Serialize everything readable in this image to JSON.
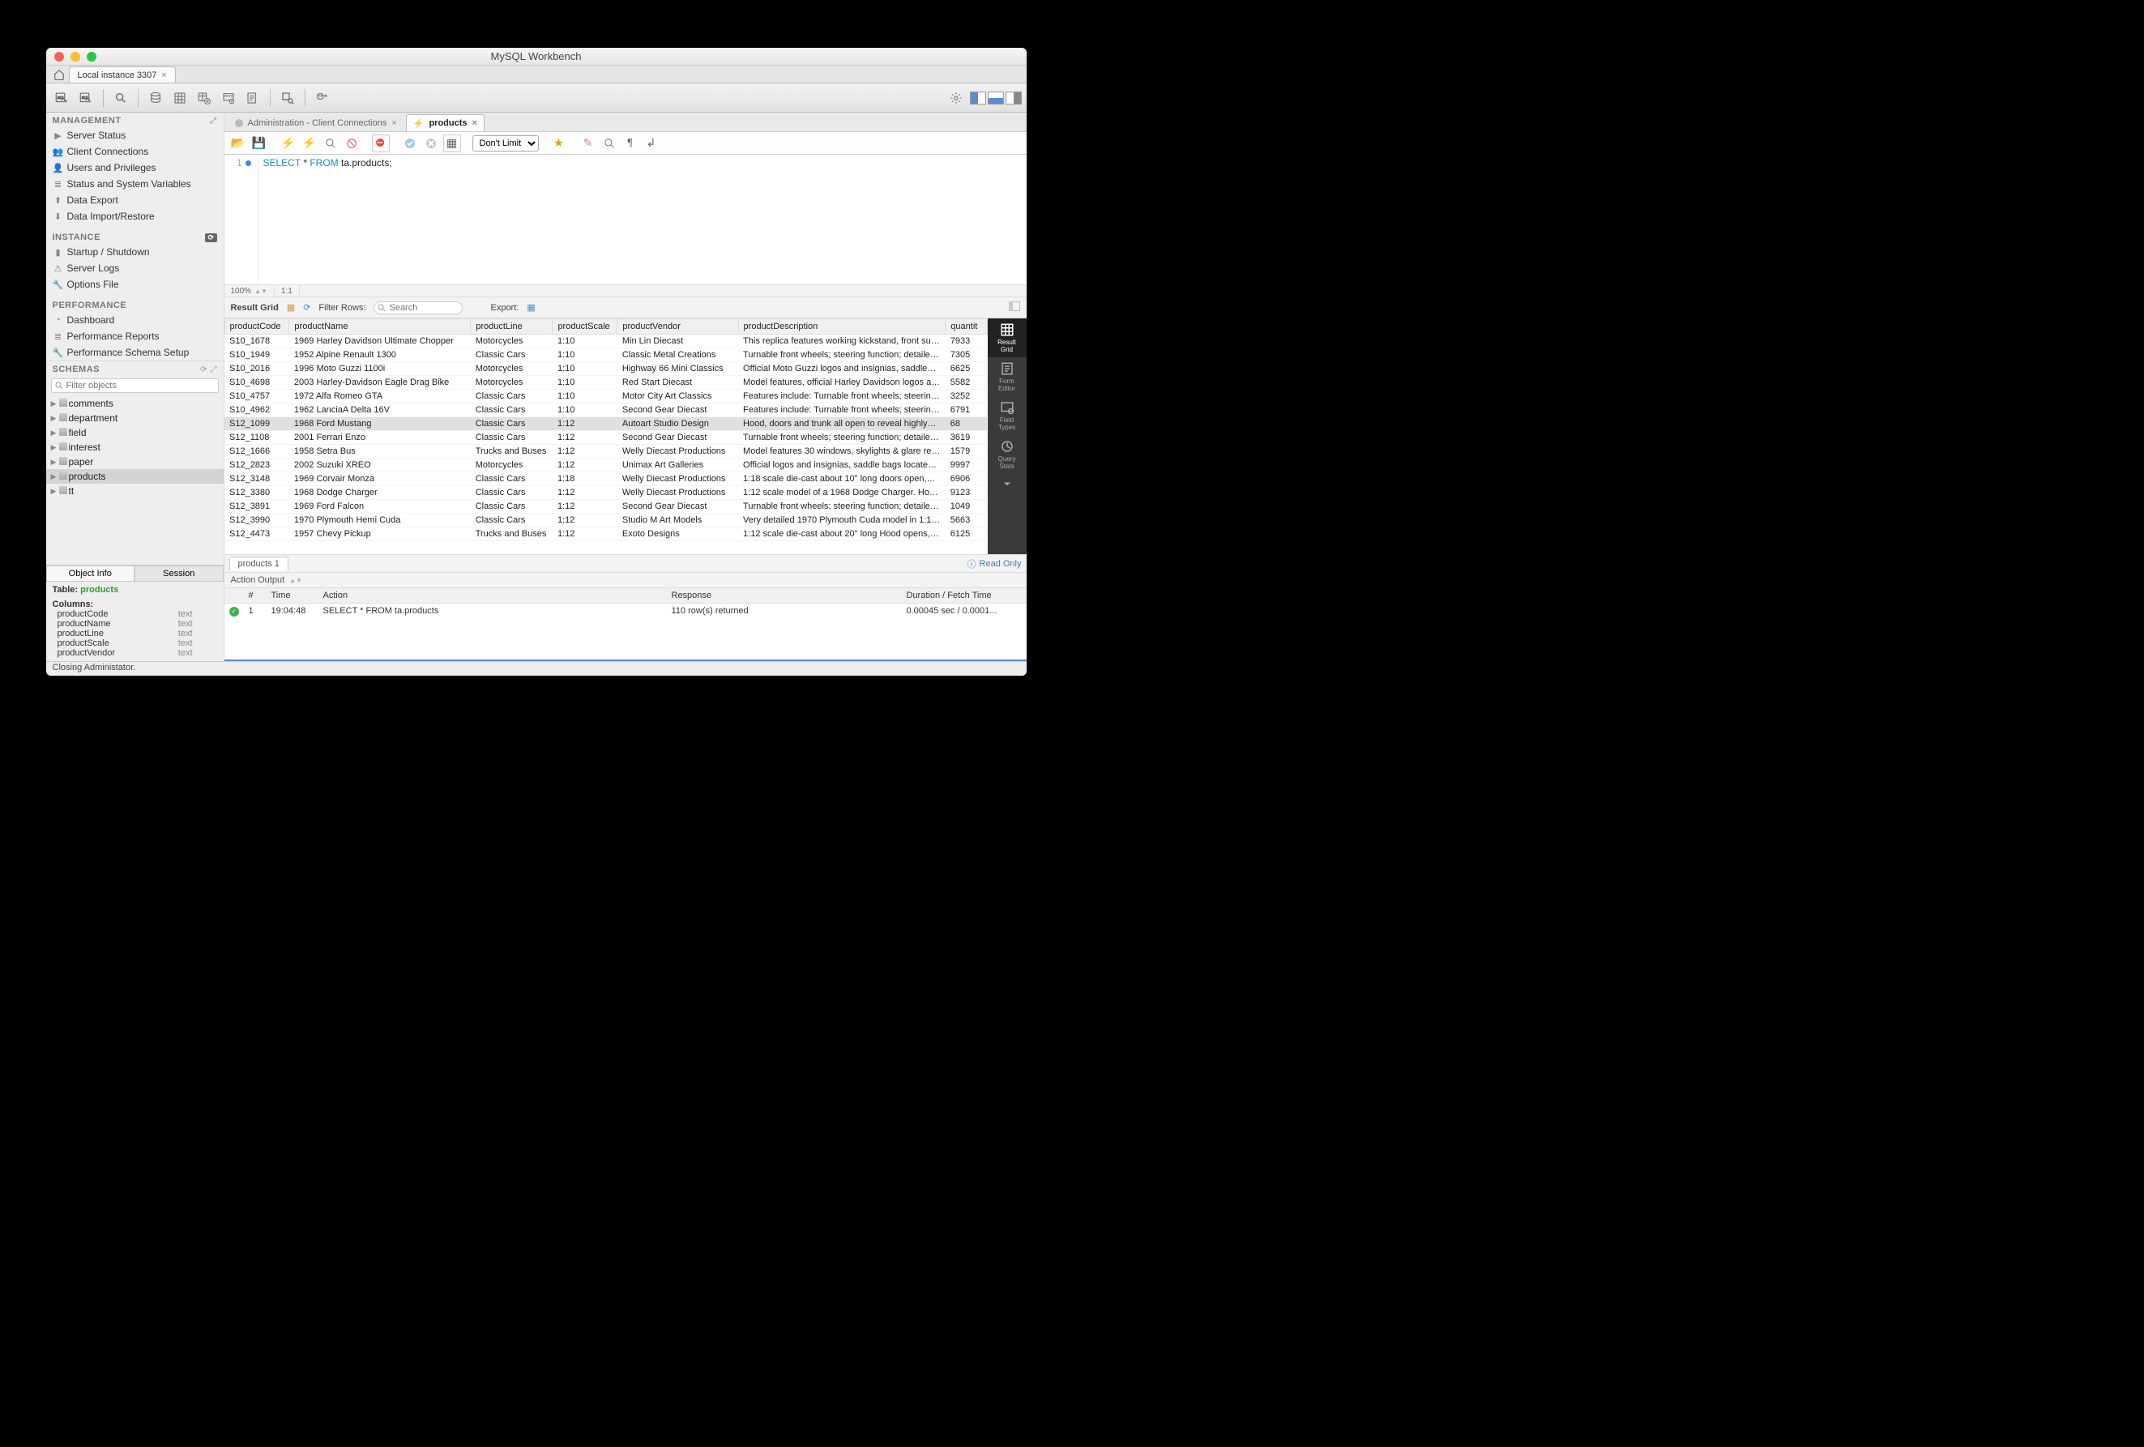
{
  "window": {
    "title": "MySQL Workbench"
  },
  "connectionTab": {
    "label": "Local instance 3307"
  },
  "sidebar": {
    "management": {
      "header": "MANAGEMENT",
      "items": [
        {
          "label": "Server Status",
          "icon": "▶"
        },
        {
          "label": "Client Connections",
          "icon": "👥"
        },
        {
          "label": "Users and Privileges",
          "icon": "👤"
        },
        {
          "label": "Status and System Variables",
          "icon": "≣"
        },
        {
          "label": "Data Export",
          "icon": "⬆"
        },
        {
          "label": "Data Import/Restore",
          "icon": "⬇"
        }
      ]
    },
    "instance": {
      "header": "INSTANCE",
      "items": [
        {
          "label": "Startup / Shutdown",
          "icon": "▮"
        },
        {
          "label": "Server Logs",
          "icon": "⚠"
        },
        {
          "label": "Options File",
          "icon": "🔧"
        }
      ]
    },
    "performance": {
      "header": "PERFORMANCE",
      "items": [
        {
          "label": "Dashboard",
          "icon": "◔"
        },
        {
          "label": "Performance Reports",
          "icon": "≣"
        },
        {
          "label": "Performance Schema Setup",
          "icon": "🔧"
        }
      ]
    },
    "schemas": {
      "header": "SCHEMAS",
      "filterPlaceholder": "Filter objects",
      "items": [
        {
          "label": "comments"
        },
        {
          "label": "department"
        },
        {
          "label": "field"
        },
        {
          "label": "interest"
        },
        {
          "label": "paper"
        },
        {
          "label": "products",
          "selected": true
        },
        {
          "label": "tt"
        }
      ]
    },
    "infoTabs": {
      "objectInfo": "Object Info",
      "session": "Session"
    },
    "tableInfo": {
      "label": "Table:",
      "name": "products",
      "columnsHeader": "Columns:",
      "columns": [
        {
          "name": "productCode",
          "type": "text"
        },
        {
          "name": "productName",
          "type": "text"
        },
        {
          "name": "productLine",
          "type": "text"
        },
        {
          "name": "productScale",
          "type": "text"
        },
        {
          "name": "productVendor",
          "type": "text"
        }
      ]
    }
  },
  "queryTabs": [
    {
      "label": "Administration - Client Connections",
      "selected": false
    },
    {
      "label": "products",
      "selected": true
    }
  ],
  "queryToolbar": {
    "limitSelect": "Don't Limit"
  },
  "editor": {
    "lineNumber": "1",
    "sql": {
      "kw1": "SELECT",
      "star": "*",
      "kw2": "FROM",
      "ident": "ta.products;"
    },
    "zoom": "100%",
    "pos": "1:1"
  },
  "gridBar": {
    "title": "Result Grid",
    "filterLabel": "Filter Rows:",
    "searchPlaceholder": "Search",
    "exportLabel": "Export:"
  },
  "grid": {
    "columns": [
      "productCode",
      "productName",
      "productLine",
      "productScale",
      "productVendor",
      "productDescription",
      "quantit"
    ],
    "colWidths": [
      "75px",
      "210px",
      "95px",
      "75px",
      "140px",
      "240px",
      "48px"
    ],
    "selectedRow": 6,
    "rows": [
      [
        "S10_1678",
        "1969 Harley Davidson Ultimate Chopper",
        "Motorcycles",
        "1:10",
        "Min Lin Diecast",
        "This replica features working kickstand, front su…",
        "7933"
      ],
      [
        "S10_1949",
        "1952 Alpine Renault 1300",
        "Classic Cars",
        "1:10",
        "Classic Metal Creations",
        "Turnable front wheels; steering function; detaile…",
        "7305"
      ],
      [
        "S10_2016",
        "1996 Moto Guzzi 1100i",
        "Motorcycles",
        "1:10",
        "Highway 66 Mini Classics",
        "Official Moto Guzzi logos and insignias, saddle…",
        "6625"
      ],
      [
        "S10_4698",
        "2003 Harley-Davidson Eagle Drag Bike",
        "Motorcycles",
        "1:10",
        "Red Start Diecast",
        "Model features, official Harley Davidson logos a…",
        "5582"
      ],
      [
        "S10_4757",
        "1972 Alfa Romeo GTA",
        "Classic Cars",
        "1:10",
        "Motor City Art Classics",
        "Features include: Turnable front wheels; steerin…",
        "3252"
      ],
      [
        "S10_4962",
        "1962 LanciaA Delta 16V",
        "Classic Cars",
        "1:10",
        "Second Gear Diecast",
        "Features include: Turnable front wheels; steerin…",
        "6791"
      ],
      [
        "S12_1099",
        "1968 Ford Mustang",
        "Classic Cars",
        "1:12",
        "Autoart Studio Design",
        "Hood, doors and trunk all open to reveal highly…",
        "68"
      ],
      [
        "S12_1108",
        "2001 Ferrari Enzo",
        "Classic Cars",
        "1:12",
        "Second Gear Diecast",
        "Turnable front wheels; steering function; detaile…",
        "3619"
      ],
      [
        "S12_1666",
        "1958 Setra Bus",
        "Trucks and Buses",
        "1:12",
        "Welly Diecast Productions",
        "Model features 30 windows, skylights & glare re…",
        "1579"
      ],
      [
        "S12_2823",
        "2002 Suzuki XREO",
        "Motorcycles",
        "1:12",
        "Unimax Art Galleries",
        "Official logos and insignias, saddle bags located…",
        "9997"
      ],
      [
        "S12_3148",
        "1969 Corvair Monza",
        "Classic Cars",
        "1:18",
        "Welly Diecast Productions",
        "1:18 scale die-cast about 10\" long doors open,…",
        "6906"
      ],
      [
        "S12_3380",
        "1968 Dodge Charger",
        "Classic Cars",
        "1:12",
        "Welly Diecast Productions",
        "1:12 scale model of a 1968 Dodge Charger. Ho…",
        "9123"
      ],
      [
        "S12_3891",
        "1969 Ford Falcon",
        "Classic Cars",
        "1:12",
        "Second Gear Diecast",
        "Turnable front wheels; steering function; detaile…",
        "1049"
      ],
      [
        "S12_3990",
        "1970 Plymouth Hemi Cuda",
        "Classic Cars",
        "1:12",
        "Studio M Art Models",
        "Very detailed 1970 Plymouth Cuda model in 1:1…",
        "5663"
      ],
      [
        "S12_4473",
        "1957 Chevy Pickup",
        "Trucks and Buses",
        "1:12",
        "Exoto Designs",
        "1:12 scale die-cast about 20\" long Hood opens,…",
        "6125"
      ]
    ],
    "footerTab": "products 1",
    "readOnly": "Read Only"
  },
  "sideTabs": [
    {
      "label": "Result\nGrid",
      "selected": true
    },
    {
      "label": "Form\nEditor"
    },
    {
      "label": "Field\nTypes"
    },
    {
      "label": "Query\nStats"
    }
  ],
  "actionOutput": {
    "header": "Action Output",
    "columns": {
      "num": "#",
      "time": "Time",
      "action": "Action",
      "response": "Response",
      "duration": "Duration / Fetch Time"
    },
    "row": {
      "num": "1",
      "time": "19:04:48",
      "action": "SELECT * FROM ta.products",
      "response": "110 row(s) returned",
      "duration": "0.00045 sec / 0.0001..."
    }
  },
  "statusBar": {
    "text": "Closing Administator."
  }
}
